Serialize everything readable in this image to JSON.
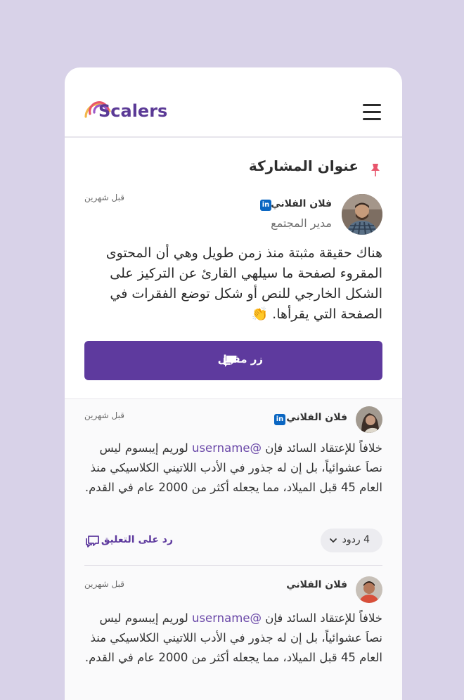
{
  "app": {
    "logo_text": "Scalers",
    "logo_icon": "rainbow-arc-icon",
    "menu_icon": "hamburger-menu-icon"
  },
  "post": {
    "title": "عنوان المشاركة",
    "pin_icon": "pin-icon",
    "author": {
      "name": "فلان الفلاني",
      "role": "مدير المجتمع",
      "linkedin": "in"
    },
    "time": "قبل شهرين",
    "body": "هناك حقيقة مثبتة منذ زمن طويل وهي أن المحتوى المقروء لصفحة ما سيلهي القارئ عن التركيز على الشكل الخارجي للنص أو شكل توضع الفقرات في الصفحة التي يقرأها. 👏",
    "cta_label": "زر مفعل",
    "cta_icon": "chat-bubbles-icon"
  },
  "comments": [
    {
      "author": "فلان الفلاني",
      "linkedin": "in",
      "time": "قبل شهرين",
      "prefix": "خلافاً للإعتقاد السائد فإن ",
      "mention": "@username",
      "suffix": " لوريم إيبسوم ليس نصاَ عشوائياً، بل إن له جذور في الأدب اللاتيني الكلاسيكي منذ العام 45 قبل الميلاد، مما يجعله أكثر من 2000 عام في القدم.",
      "replies_label": "4 ردود",
      "reply_label": "رد على التعليق"
    },
    {
      "author": "فلان الفلاني",
      "time": "قبل شهرين",
      "prefix": "خلافاً للإعتقاد السائد فإن ",
      "mention": "@username",
      "suffix": " لوريم إيبسوم ليس نصاَ عشوائياً، بل إن له جذور في الأدب اللاتيني الكلاسيكي منذ العام 45 قبل الميلاد، مما يجعله أكثر من 2000 عام في القدم."
    }
  ],
  "colors": {
    "brand": "#5e3a9e",
    "background": "#d8d2e8",
    "linkedin": "#0a66c2"
  }
}
